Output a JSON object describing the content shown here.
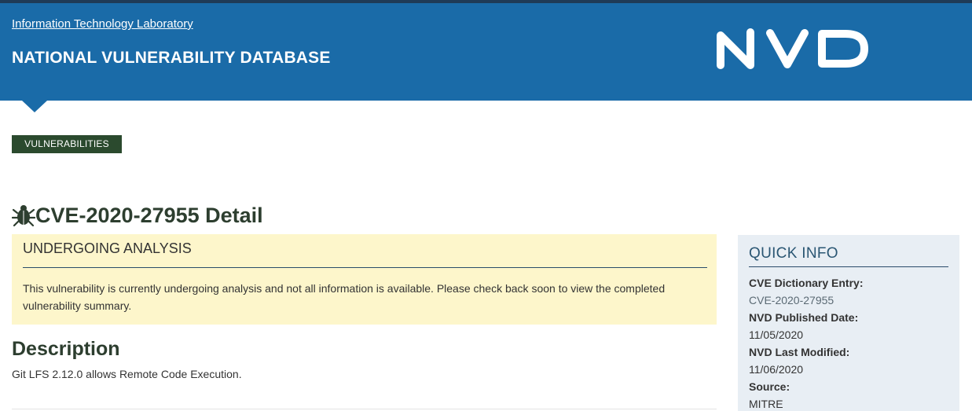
{
  "header": {
    "itl_link": "Information Technology Laboratory",
    "title": "NATIONAL VULNERABILITY DATABASE",
    "logo_text": "NVD",
    "logo_icon": "nvd-logo",
    "bg_color": "#1a6ba8"
  },
  "nav": {
    "vulnerabilities_button": "VULNERABILITIES"
  },
  "page": {
    "title": "CVE-2020-27955 Detail",
    "title_icon": "bug-icon"
  },
  "analysis": {
    "heading": "UNDERGOING ANALYSIS",
    "text": "This vulnerability is currently undergoing analysis and not all information is available. Please check back soon to view the completed vulnerability summary."
  },
  "description": {
    "heading": "Description",
    "text": "Git LFS 2.12.0 allows Remote Code Execution."
  },
  "quick_info": {
    "heading": "QUICK INFO",
    "cve_entry_label": "CVE Dictionary Entry:",
    "cve_entry_value": "CVE-2020-27955",
    "published_label": "NVD Published Date:",
    "published_value": "11/05/2020",
    "modified_label": "NVD Last Modified:",
    "modified_value": "11/06/2020",
    "source_label": "Source:",
    "source_value": "MITRE"
  }
}
